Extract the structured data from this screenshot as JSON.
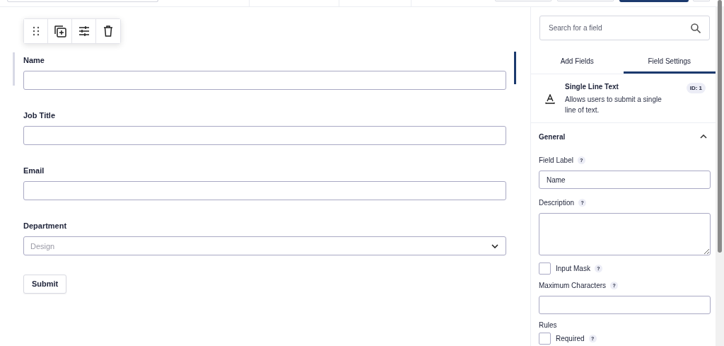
{
  "field_toolbar": {
    "buttons": [
      {
        "kind": "drag"
      },
      {
        "kind": "duplicate"
      },
      {
        "kind": "settings"
      },
      {
        "kind": "delete"
      }
    ]
  },
  "form": {
    "fields": [
      {
        "kind": "text",
        "label": "Name",
        "selected": true
      },
      {
        "kind": "text",
        "label": "Job Title",
        "selected": false
      },
      {
        "kind": "text",
        "label": "Email",
        "selected": false
      },
      {
        "kind": "select",
        "label": "Department",
        "placeholder": "Design",
        "selected": false
      }
    ],
    "submit": "Submit"
  },
  "sidebar": {
    "search": {
      "placeholder": "Search for a field"
    },
    "tabs": [
      {
        "label": "Add Fields",
        "selected": false
      },
      {
        "label": "Field Settings",
        "selected": true
      }
    ],
    "field_info": {
      "title": "Single Line Text",
      "description": "Allows users to submit a single line of text.",
      "id_badge": "ID: 1"
    },
    "section": {
      "title": "General",
      "expanded": true
    },
    "settings": [
      {
        "kind": "input",
        "label": "Field Label",
        "help": "?",
        "value": "Name"
      },
      {
        "kind": "textarea",
        "label": "Description",
        "help": "?"
      },
      {
        "kind": "checkbox",
        "label": "Input Mask",
        "help": "?",
        "checked": false
      },
      {
        "kind": "input",
        "label": "Maximum Characters",
        "help": "?"
      },
      {
        "kind": "heading",
        "label": "Rules"
      },
      {
        "kind": "checkbox",
        "label": "Required",
        "help": "?",
        "checked": false
      }
    ]
  }
}
